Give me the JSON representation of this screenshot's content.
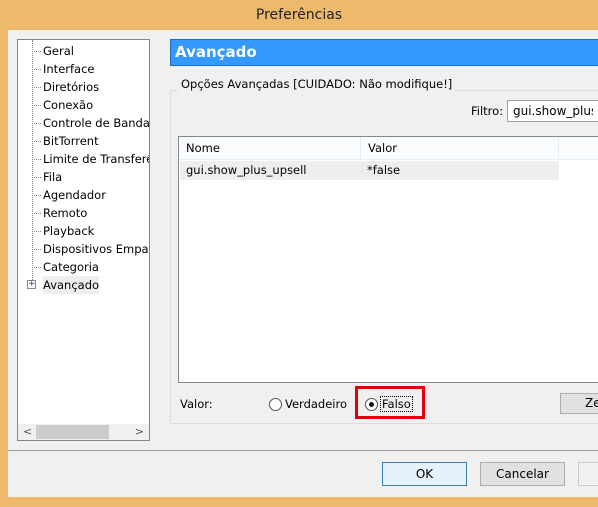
{
  "window": {
    "title": "Preferências"
  },
  "sidebar": {
    "items": [
      {
        "label": "Geral"
      },
      {
        "label": "Interface"
      },
      {
        "label": "Diretórios"
      },
      {
        "label": "Conexão"
      },
      {
        "label": "Controle de Banda"
      },
      {
        "label": "BitTorrent"
      },
      {
        "label": "Limite de Transferência"
      },
      {
        "label": "Fila"
      },
      {
        "label": "Agendador"
      },
      {
        "label": "Remoto"
      },
      {
        "label": "Playback"
      },
      {
        "label": "Dispositivos Emparelhados"
      },
      {
        "label": "Categoria"
      },
      {
        "label": "Avançado",
        "selected": true
      }
    ]
  },
  "panel": {
    "title": "Avançado",
    "group_label": "Opções Avançadas [CUIDADO: Não modifique!]",
    "filter_label": "Filtro:",
    "filter_value": "gui.show_plus_upsell",
    "columns": [
      "Nome",
      "Valor"
    ],
    "rows": [
      {
        "name": "gui.show_plus_upsell",
        "value": "*false"
      }
    ],
    "value_label": "Valor:",
    "radio_true": "Verdadeiro",
    "radio_false": "Falso",
    "selected_value": "Falso",
    "reset_button": "Ze"
  },
  "footer": {
    "ok": "OK",
    "cancel": "Cancelar"
  },
  "colors": {
    "titlebar": "#edb96b",
    "header": "#3399ff",
    "highlight": "#e0000a"
  }
}
